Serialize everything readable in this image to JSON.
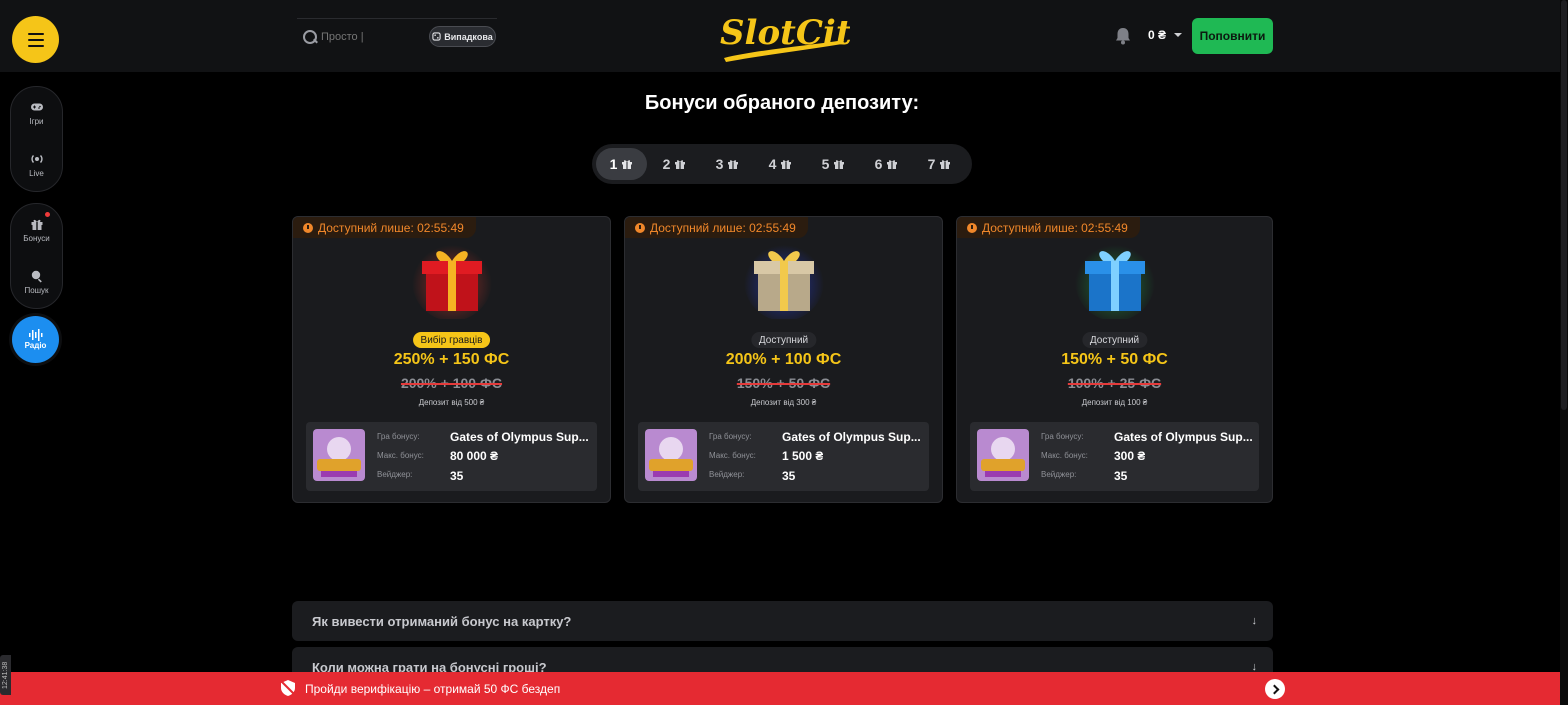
{
  "header": {
    "search_placeholder": "Просто |",
    "random_label": "Випадкова",
    "logo_text": "SlotCity",
    "balance": "0 ₴",
    "deposit_label": "Поповнити"
  },
  "sidebar": {
    "games": "Ігри",
    "live": "Live",
    "bonuses": "Бонуси",
    "search": "Пошук",
    "radio": "Радіо"
  },
  "page_title": "Бонуси обраного депозиту:",
  "tabs": [
    "1",
    "2",
    "3",
    "4",
    "5",
    "6",
    "7"
  ],
  "active_tab": "1",
  "cards": [
    {
      "timer": "Доступний лише: 02:55:49",
      "gift_color": "red",
      "badge": "Вибір гравців",
      "offer": "250% + 150 ФС",
      "old_offer": "200% + 100 ФС",
      "min_deposit": "Депозит від 500 ₴",
      "game_label": "Гра бонусу:",
      "game": "Gates of Olympus Sup...",
      "max_label": "Макс. бонус:",
      "max_bonus": "80 000 ₴",
      "wager_label": "Вейджер:",
      "wager": "35"
    },
    {
      "timer": "Доступний лише: 02:55:49",
      "gift_color": "gold",
      "badge": "Доступний",
      "offer": "200% + 100 ФС",
      "old_offer": "150% + 50 ФС",
      "min_deposit": "Депозит від 300 ₴",
      "game_label": "Гра бонусу:",
      "game": "Gates of Olympus Sup...",
      "max_label": "Макс. бонус:",
      "max_bonus": "1 500 ₴",
      "wager_label": "Вейджер:",
      "wager": "35"
    },
    {
      "timer": "Доступний лише: 02:55:49",
      "gift_color": "blue",
      "badge": "Доступний",
      "offer": "150% + 50 ФС",
      "old_offer": "100% + 25 ФС",
      "min_deposit": "Депозит від 100 ₴",
      "game_label": "Гра бонусу:",
      "game": "Gates of Olympus Sup...",
      "max_label": "Макс. бонус:",
      "max_bonus": "300 ₴",
      "wager_label": "Вейджер:",
      "wager": "35"
    }
  ],
  "faq": [
    "Як вивести отриманий бонус на картку?",
    "Коли можна грати на бонусні гроші?"
  ],
  "banner_text": "Пройди верифікацію – отримай 50 ФС бездеп",
  "clock_tag": "12:41:38",
  "colors": {
    "accent_yellow": "#f5c518",
    "deposit_green": "#1fb954",
    "radio_blue": "#1c8ef0",
    "banner_red": "#e52a32",
    "timer_orange": "#f0872a"
  }
}
